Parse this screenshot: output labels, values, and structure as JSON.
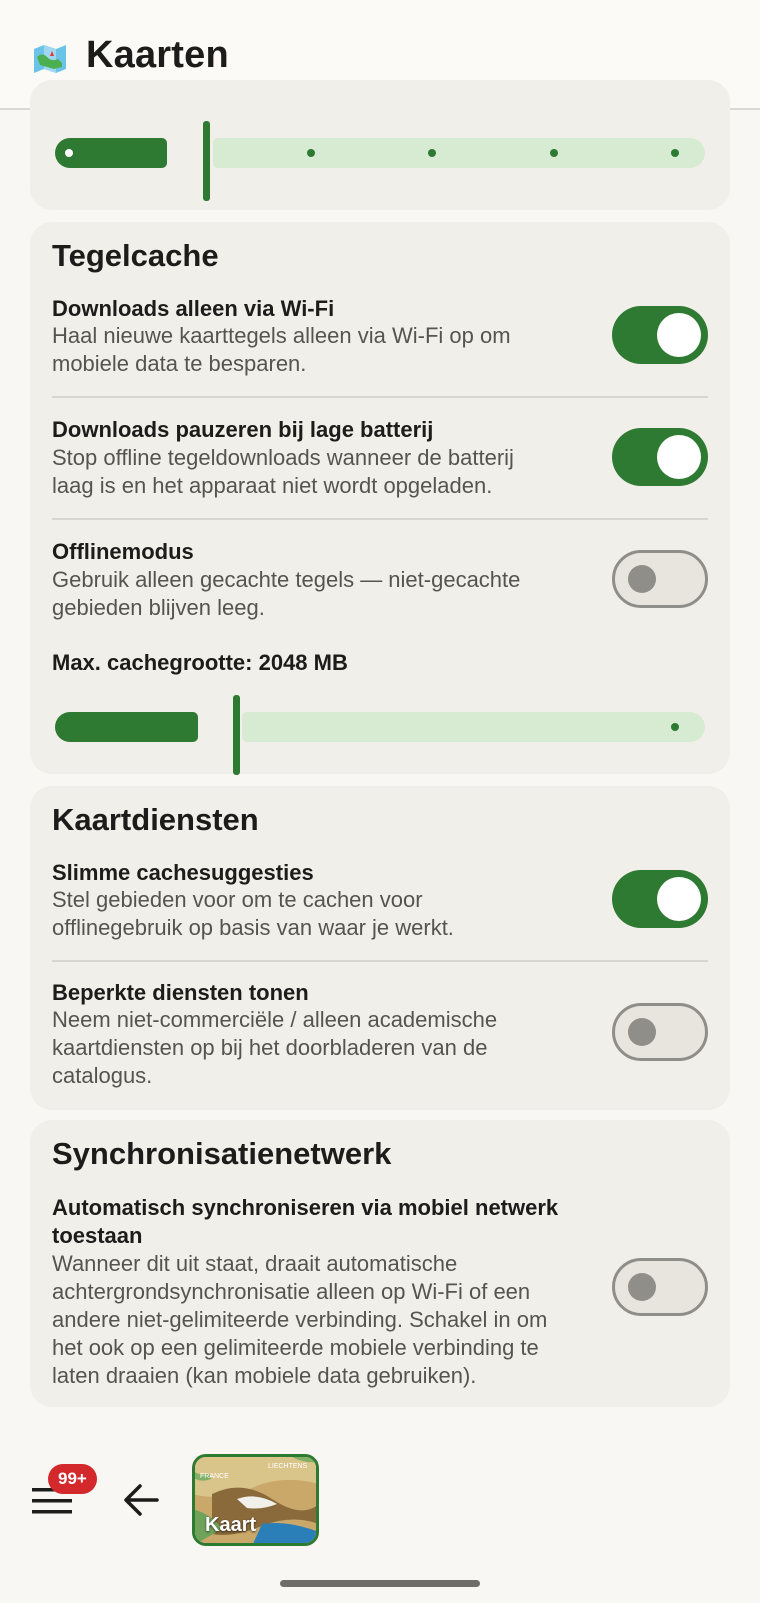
{
  "appbar": {
    "title": "Kaarten",
    "icon": "map-icon"
  },
  "top_slider": {
    "value_fraction": 0.2,
    "steps": 6
  },
  "tile_cache": {
    "title": "Tegelcache",
    "settings": [
      {
        "title": "Downloads alleen via Wi-Fi",
        "desc_lines": [
          "Haal nieuwe kaarttegels alleen via Wi-Fi op om",
          "mobiele data te besparen."
        ],
        "enabled": true
      },
      {
        "title": "Downloads pauzeren bij lage batterij",
        "desc_lines": [
          "Stop offline tegeldownloads wanneer de batterij",
          "laag is en het apparaat niet wordt opgeladen."
        ],
        "enabled": true
      },
      {
        "title": "Offlinemodus",
        "desc_lines": [
          "Gebruik alleen gecachte tegels — niet-gecachte",
          "gebieden blijven leeg."
        ],
        "enabled": false
      }
    ],
    "cache_size_label": "Max. cachegrootte: 2048 MB",
    "cache_slider_fraction": 0.25
  },
  "map_services": {
    "title": "Kaartdiensten",
    "settings": [
      {
        "title": "Slimme cachesuggesties",
        "desc_lines": [
          "Stel gebieden voor om te cachen voor",
          "offlinegebruik op basis van waar je werkt."
        ],
        "enabled": true
      },
      {
        "title": "Beperkte diensten tonen",
        "desc_lines": [
          "Neem niet-commerciële / alleen academische",
          "kaartdiensten op bij het doorbladeren van de",
          "catalogus."
        ],
        "enabled": false
      }
    ]
  },
  "sync_network": {
    "title": "Synchronisatienetwerk",
    "setting": {
      "title_lines": [
        "Automatisch synchroniseren via mobiel netwerk",
        "toestaan"
      ],
      "desc_lines": [
        "Wanneer dit uit staat, draait automatische",
        "achtergrondsynchronisatie alleen op Wi-Fi of een",
        "andere niet-gelimiteerde verbinding. Schakel in om",
        "het ook op een gelimiteerde mobiele verbinding te",
        "laten draaien (kan mobiele data gebruiken)."
      ],
      "enabled": false
    }
  },
  "bottom_bar": {
    "badge": "99+",
    "map_thumb_label": "Kaart",
    "map_thumb_text_1": "FRANCE",
    "map_thumb_text_2": "LIECHTENS"
  },
  "colors": {
    "accent": "#2f7a33",
    "track_inactive": "#d6ebd2",
    "badge": "#d3282c"
  }
}
